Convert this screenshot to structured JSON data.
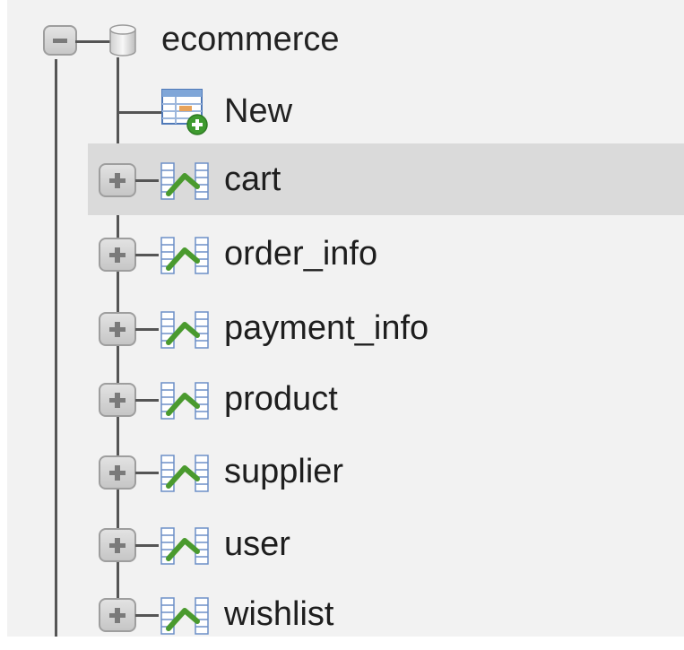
{
  "database": {
    "name": "ecommerce",
    "toggle_state": "expanded",
    "icon": "database-icon"
  },
  "new_item": {
    "label": "New",
    "icon": "new-table-icon"
  },
  "tables": [
    {
      "name": "cart",
      "selected": true
    },
    {
      "name": "order_info",
      "selected": false
    },
    {
      "name": "payment_info",
      "selected": false
    },
    {
      "name": "product",
      "selected": false
    },
    {
      "name": "supplier",
      "selected": false
    },
    {
      "name": "user",
      "selected": false
    },
    {
      "name": "wishlist",
      "selected": false
    }
  ],
  "colors": {
    "panel_background": "#f2f2f2",
    "selected_row": "#dadada",
    "tree_line": "#555555",
    "table_icon_green": "#4a9a2e"
  }
}
